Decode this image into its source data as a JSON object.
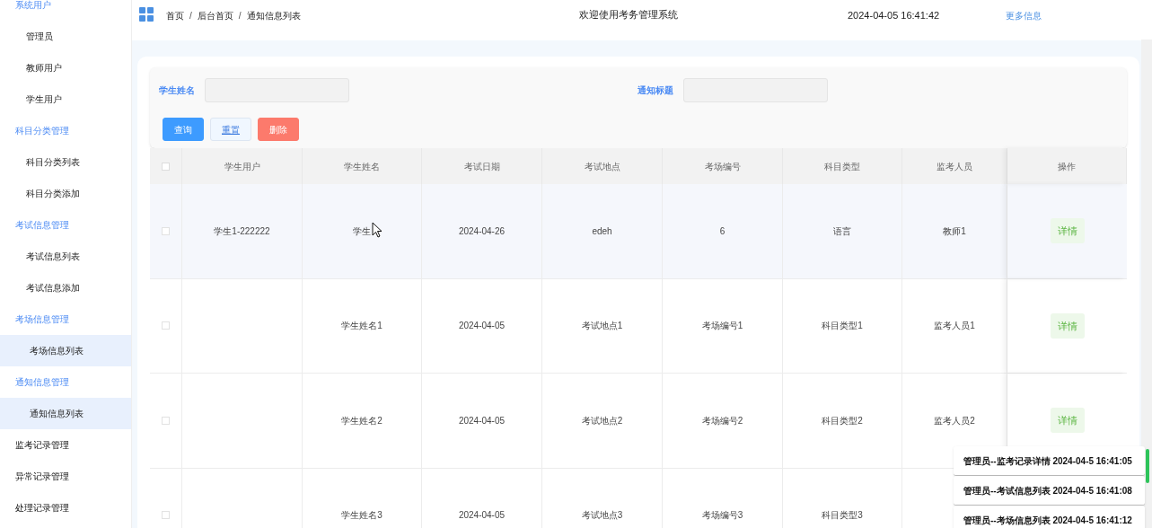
{
  "sidebar": {
    "items": [
      {
        "label": "系统用户",
        "expanded": true,
        "children": [
          {
            "label": "管理员",
            "selected": false
          },
          {
            "label": "教师用户",
            "selected": false
          },
          {
            "label": "学生用户",
            "selected": false
          }
        ]
      },
      {
        "label": "科目分类管理",
        "expanded": true,
        "children": [
          {
            "label": "科目分类列表",
            "selected": false
          },
          {
            "label": "科目分类添加",
            "selected": false
          }
        ]
      },
      {
        "label": "考试信息管理",
        "expanded": true,
        "children": [
          {
            "label": "考试信息列表",
            "selected": false
          },
          {
            "label": "考试信息添加",
            "selected": false
          }
        ]
      },
      {
        "label": "考场信息管理",
        "expanded": true,
        "children": [
          {
            "label": "考场信息列表",
            "selected": true
          }
        ]
      },
      {
        "label": "通知信息管理",
        "expanded": true,
        "children": [
          {
            "label": "通知信息列表",
            "selected": true
          }
        ]
      },
      {
        "label": "监考记录管理",
        "expanded": false
      },
      {
        "label": "异常记录管理",
        "expanded": false
      },
      {
        "label": "处理记录管理",
        "expanded": false
      }
    ]
  },
  "header": {
    "breadcrumb": [
      "首页",
      "后台首页",
      "通知信息列表"
    ],
    "separator": "/",
    "title": "欢迎使用考务管理系统",
    "datetime": "2024-04-05 16:41:42",
    "more_link": "更多信息"
  },
  "filters": [
    {
      "label": "学生姓名"
    },
    {
      "label": "通知标题"
    }
  ],
  "buttons": [
    {
      "label": "查询",
      "kind": "primary"
    },
    {
      "label": "重置",
      "kind": "plain"
    },
    {
      "label": "删除",
      "kind": "danger"
    }
  ],
  "table": {
    "columns": [
      "学生用户",
      "学生姓名",
      "考试日期",
      "考试地点",
      "考场编号",
      "科目类型",
      "监考人员",
      "操作"
    ],
    "all_checked": false,
    "rows": [
      {
        "checked": false,
        "cells": [
          "学生1-222222",
          "学生",
          "2024-04-26",
          "edeh",
          "6",
          "语言",
          "教师1"
        ],
        "action": "详情"
      },
      {
        "checked": false,
        "cells": [
          "",
          "学生姓名1",
          "2024-04-05",
          "考试地点1",
          "考场编号1",
          "科目类型1",
          "监考人员1"
        ],
        "action": "详情"
      },
      {
        "checked": false,
        "cells": [
          "",
          "学生姓名2",
          "2024-04-05",
          "考试地点2",
          "考场编号2",
          "科目类型2",
          "监考人员2"
        ],
        "action": "详情"
      },
      {
        "checked": false,
        "cells": [
          "",
          "学生姓名3",
          "2024-04-05",
          "考试地点3",
          "考场编号3",
          "科目类型3"
        ]
      }
    ]
  },
  "notifications": [
    "管理员--监考记录详情 2024-04-5 16:41:05",
    "管理员--考试信息列表 2024-04-5 16:41:08",
    "管理员--考场信息列表 2024-04-5 16:41:12"
  ]
}
